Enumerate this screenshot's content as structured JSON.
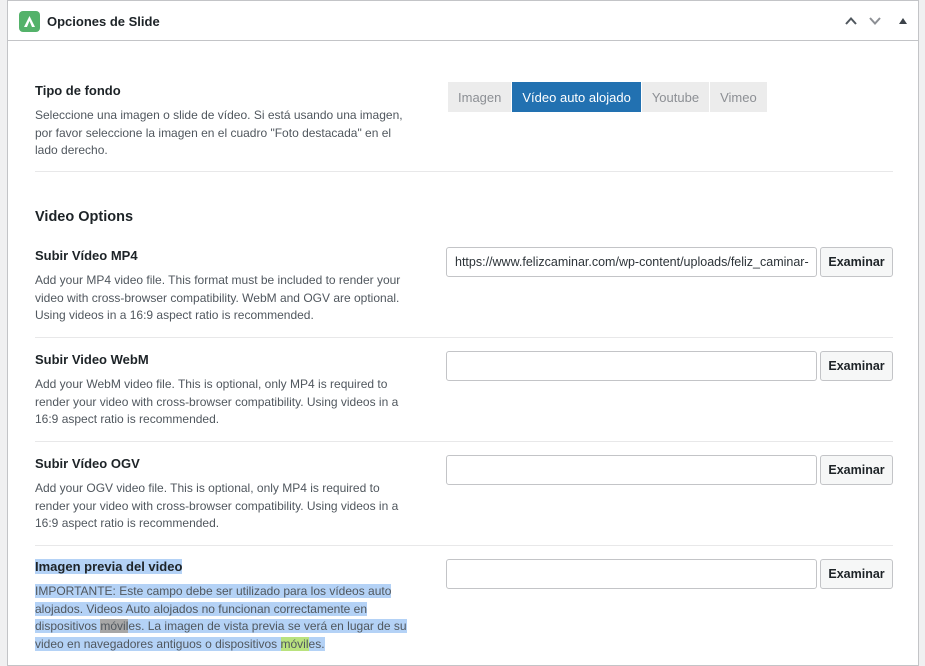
{
  "header": {
    "title": "Opciones de Slide",
    "icons": [
      "logo-icon",
      "chevron-up-icon",
      "chevron-down-icon",
      "triangle-up-icon"
    ]
  },
  "background": {
    "title": "Tipo de fondo",
    "desc": "Seleccione una imagen o slide de vídeo. Si está usando una imagen, por favor seleccione la imagen en el cuadro \"Foto destacada\" en el lado derecho.",
    "desc_lines": [
      "Seleccione una imagen o slide de vídeo. Si está usando una imagen,",
      "por favor seleccione la imagen en el cuadro \"Foto destacada\" en el",
      "lado derecho."
    ],
    "options": [
      "Imagen",
      "Vídeo auto alojado",
      "Youtube",
      "Vimeo"
    ],
    "selected": "Vídeo auto alojado"
  },
  "video_options": {
    "title": "Video Options",
    "browse_label": "Examinar",
    "mp4": {
      "title": "Subir Vídeo MP4",
      "desc_lines": [
        "Add your MP4 video file. This format must be included to render your",
        "video with cross-browser compatibility. WebM and OGV are optional.",
        "Using videos in a 16:9 aspect ratio is recommended."
      ],
      "value": "https://www.felizcaminar.com/wp-content/uploads/feliz_caminar-"
    },
    "webm": {
      "title": "Subir Video WebM",
      "desc_lines": [
        "Add your WebM video file. This is optional, only MP4 is required to",
        "render your video with cross-browser compatibility. Using videos in a",
        "16:9 aspect ratio is recommended."
      ],
      "value": ""
    },
    "ogv": {
      "title": "Subir Vídeo OGV",
      "desc_lines": [
        "Add your OGV video file. This is optional, only MP4 is required to",
        "render your video with cross-browser compatibility. Using videos in a",
        "16:9 aspect ratio is recommended."
      ],
      "value": ""
    },
    "preview": {
      "title": "Imagen previa del video",
      "line1": "IMPORTANTE: Este campo debe ser utilizado para los vídeos auto",
      "line2": "alojados. Videos Auto alojados no funcionan correctamente en",
      "line3_a": "dispositivos ",
      "line3_hl": "móvil",
      "line3_b": "es. La imagen de vista previa se verá en lugar de su",
      "line4_a": "video en navegadores antiguos o dispositivos ",
      "line4_hl": "móvil",
      "line4_b": "es.",
      "value": ""
    }
  },
  "colors": {
    "accent": "#2271b1",
    "logo": "#54b26a",
    "selection": "#b4d2f6",
    "highlight_gray": "#a7a7a7",
    "highlight_green": "#b9e27e"
  }
}
